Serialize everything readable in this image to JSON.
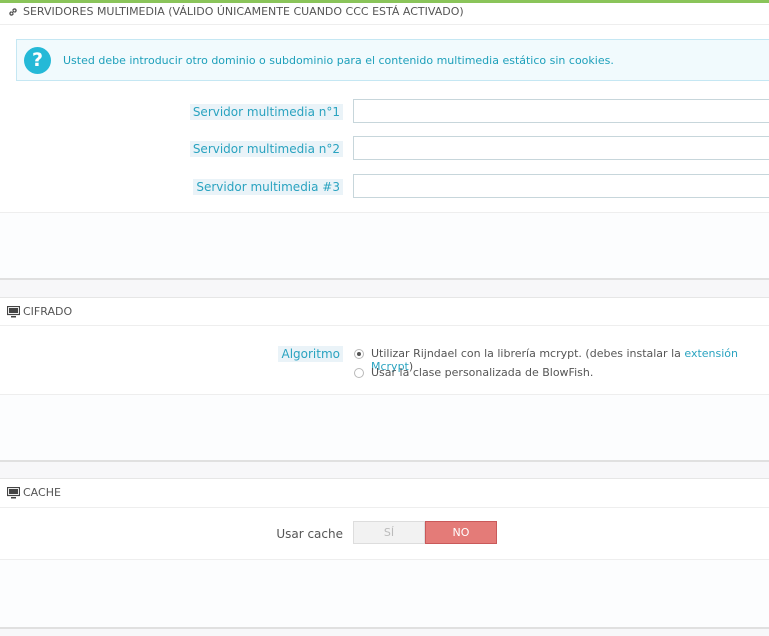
{
  "media_servers": {
    "heading": "SERVIDORES MULTIMEDIA (VÁLIDO ÚNICAMENTE CUANDO CCC ESTÁ ACTIVADO)",
    "icon": "link-icon",
    "info_message": "Usted debe introducir otro dominio o subdominio para el contenido multimedia estático sin cookies.",
    "fields": [
      {
        "label": "Servidor multimedia n°1",
        "value": ""
      },
      {
        "label": "Servidor multimedia n°2",
        "value": ""
      },
      {
        "label": "Servidor multimedia #3",
        "value": ""
      }
    ]
  },
  "encryption": {
    "heading": "CIFRADO",
    "icon": "monitor-icon",
    "label": "Algoritmo",
    "option1_text": "Utilizar Rijndael con la librería mcrypt. (debes instalar la ",
    "option1_link": "extensión Mcrypt",
    "option1_end": ")",
    "option2_text": "Usar la clase personalizada de BlowFish.",
    "selected": 1
  },
  "cache": {
    "heading": "CACHE",
    "icon": "monitor-icon",
    "label": "Usar cache",
    "yes_label": "SÍ",
    "no_label": "NO",
    "value": "no"
  },
  "colors": {
    "accent": "#25b9d7",
    "no_active": "#e47b78",
    "top_bar": "#8ac45a"
  }
}
